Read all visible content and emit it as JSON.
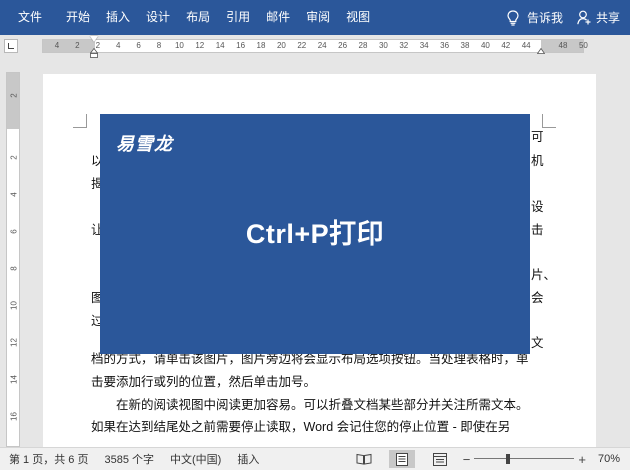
{
  "ribbon": {
    "tabs": [
      "文件",
      "开始",
      "插入",
      "设计",
      "布局",
      "引用",
      "邮件",
      "审阅",
      "视图"
    ],
    "tell_me": "告诉我",
    "share": "共享"
  },
  "ruler": {
    "h_numbers": [
      "4",
      "2",
      "2",
      "4",
      "6",
      "8",
      "10",
      "12",
      "14",
      "16",
      "18",
      "20",
      "22",
      "24",
      "26",
      "28",
      "30",
      "32",
      "34",
      "36",
      "38",
      "40",
      "42",
      "44",
      "48",
      "50"
    ],
    "v_numbers": [
      "2",
      "2",
      "4",
      "6",
      "8",
      "10",
      "12",
      "14",
      "16"
    ]
  },
  "document": {
    "paragraphs": [
      "视频提供了功能强大的方法帮助您证明您的观点。当您单击联机视频时，可以在想要添加的视频的嵌入代码中进行粘贴。您也可以键入一个关键字以联机搜索最适合您的文档的视频。",
      "为使您的文档具有专业外观，Word 提供了页眉、页脚、封面和文本框设计，这些设计可互为补充。例如，您可以添加匹配的封面、页眉和提要栏。单击“插入”，然后从不同库中选择所需元素。",
      "主题和样式也有助于文档保持协调。当您单击设计并选择新的主题时，图片、图表或 SmartArt 图形将会更改以匹配新的主题。当应用样式时，您的标题会进行更改以匹配新的主题。",
      "使用在需要位置出现的新按钮在 Word 中保存时间。若要更改图片适应文档的方式，请单击该图片，图片旁边将会显示布局选项按钮。当处理表格时，单击要添加行或列的位置，然后单击加号。",
      "在新的阅读视图中阅读更加容易。可以折叠文档某些部分并关注所需文本。如果在达到结尾处之前需要停止读取，Word 会记住您的停止位置 - 即使在另一个设备上。"
    ],
    "visible_lines": [
      "档的方式，请单击该图片，图片旁边将会显示布局选项按钮。当处理表格时，单",
      "击要添加行或列的位置，然后单击加号。",
      "在新的阅读视图中阅读更加容易。可以折叠文档某些部分并关注所需文本。",
      "如果在达到结尾处之前需要停止读取，Word 会记住您的停止位置 - 即使在另"
    ],
    "right_edge_fragments": [
      "可",
      "机",
      "设",
      "击",
      "片、",
      "会",
      "文"
    ],
    "left_edge_fragments": [
      "以",
      "揭",
      "让",
      "图",
      "过"
    ]
  },
  "banner": {
    "logo": "易雪龙",
    "title": "Ctrl+P打印",
    "color": "#2b579a"
  },
  "statusbar": {
    "page": "第 1 页，共 6 页",
    "words": "3585 个字",
    "language": "中文(中国)",
    "mode": "插入",
    "zoom": "70%",
    "zoom_level": 0.7
  },
  "colors": {
    "ribbon": "#2b579a",
    "banner": "#2b579a"
  }
}
